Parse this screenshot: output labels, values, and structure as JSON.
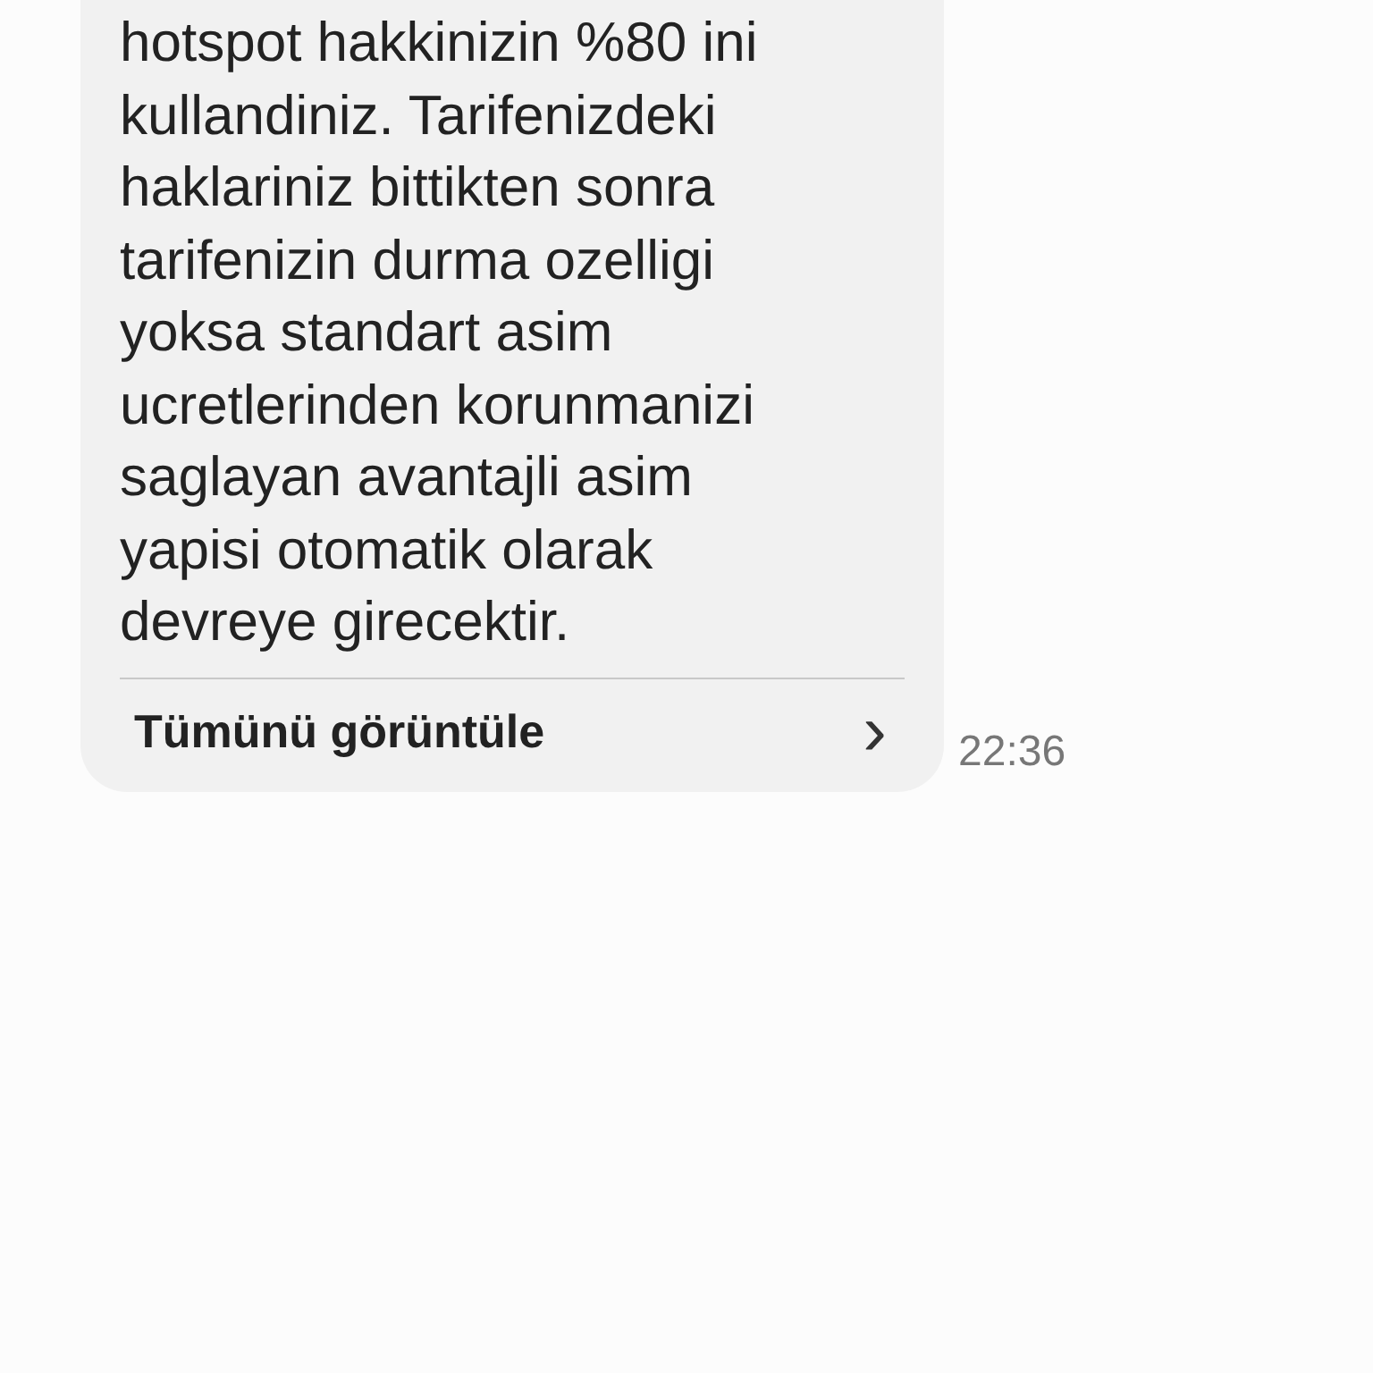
{
  "message": {
    "lines": [
      "hotspot hakkinizin %80 ini",
      "kullandiniz. Tarifenizdeki",
      "haklariniz bittikten sonra",
      "tarifenizin durma ozelligi",
      "yoksa standart asim",
      "ucretlerinden korunmanizi",
      "saglayan avantajli asim",
      "yapisi otomatik olarak",
      "devreye girecektir."
    ],
    "view_all": {
      "label": "Tümünü görüntüle",
      "chevron": "›"
    },
    "time": "22:36"
  }
}
